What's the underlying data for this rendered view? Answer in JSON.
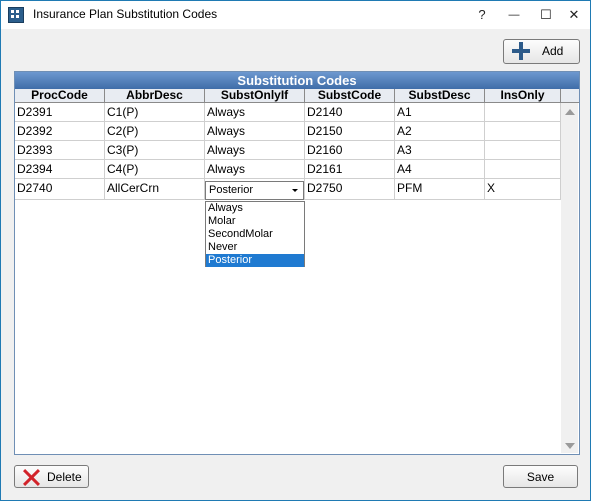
{
  "window": {
    "title": "Insurance Plan Substitution Codes",
    "help_glyph": "?",
    "minimize_glyph": "—",
    "maximize_glyph": "☐",
    "close_glyph": "✕"
  },
  "toolbar": {
    "add_label": "Add"
  },
  "grid": {
    "title": "Substitution Codes",
    "columns": [
      "ProcCode",
      "AbbrDesc",
      "SubstOnlyIf",
      "SubstCode",
      "SubstDesc",
      "InsOnly"
    ],
    "rows": [
      [
        "D2391",
        "C1(P)",
        "Always",
        "D2140",
        "A1",
        ""
      ],
      [
        "D2392",
        "C2(P)",
        "Always",
        "D2150",
        "A2",
        ""
      ],
      [
        "D2393",
        "C3(P)",
        "Always",
        "D2160",
        "A3",
        ""
      ],
      [
        "D2394",
        "C4(P)",
        "Always",
        "D2161",
        "A4",
        ""
      ],
      [
        "D2740",
        "AllCerCrn",
        "",
        "D2750",
        "PFM",
        "X"
      ]
    ],
    "editor": {
      "selected": "Posterior",
      "options": [
        "Always",
        "Molar",
        "SecondMolar",
        "Never",
        "Posterior"
      ],
      "highlighted_index": 4
    }
  },
  "footer": {
    "delete_label": "Delete",
    "save_label": "Save"
  },
  "colors": {
    "title_bar": "#ffffff",
    "grid_header": "#4f7fbe",
    "selection": "#1f7ad1",
    "delete_icon": "#d2232a",
    "add_icon": "#2d5b8a"
  }
}
